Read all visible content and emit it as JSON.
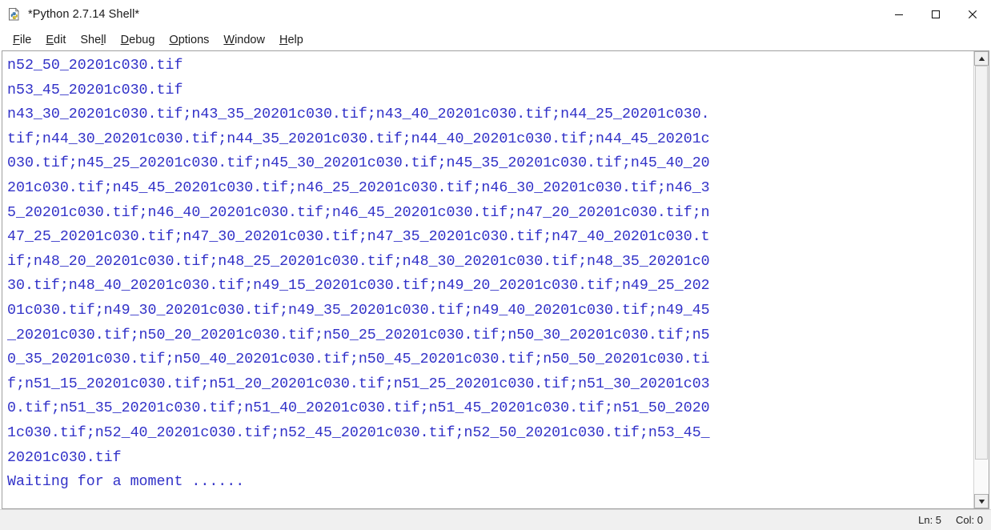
{
  "window": {
    "title": "*Python 2.7.14 Shell*",
    "icon": "python-idle-icon",
    "controls": {
      "minimize": "minimize-icon",
      "maximize": "maximize-icon",
      "close": "close-icon"
    }
  },
  "menubar": {
    "items": [
      {
        "label": "File",
        "mnemonic_index": 0
      },
      {
        "label": "Edit",
        "mnemonic_index": 0
      },
      {
        "label": "Shell",
        "mnemonic_index": 4
      },
      {
        "label": "Debug",
        "mnemonic_index": 0
      },
      {
        "label": "Options",
        "mnemonic_index": 0
      },
      {
        "label": "Window",
        "mnemonic_index": 0
      },
      {
        "label": "Help",
        "mnemonic_index": 0
      }
    ]
  },
  "shell": {
    "text_color": "#3232c8",
    "background": "#ffffff",
    "output": "n52_50_20201c030.tif\nn53_45_20201c030.tif\nn43_30_20201c030.tif;n43_35_20201c030.tif;n43_40_20201c030.tif;n44_25_20201c030.\ntif;n44_30_20201c030.tif;n44_35_20201c030.tif;n44_40_20201c030.tif;n44_45_20201c\n030.tif;n45_25_20201c030.tif;n45_30_20201c030.tif;n45_35_20201c030.tif;n45_40_20\n201c030.tif;n45_45_20201c030.tif;n46_25_20201c030.tif;n46_30_20201c030.tif;n46_3\n5_20201c030.tif;n46_40_20201c030.tif;n46_45_20201c030.tif;n47_20_20201c030.tif;n\n47_25_20201c030.tif;n47_30_20201c030.tif;n47_35_20201c030.tif;n47_40_20201c030.t\nif;n48_20_20201c030.tif;n48_25_20201c030.tif;n48_30_20201c030.tif;n48_35_20201c0\n30.tif;n48_40_20201c030.tif;n49_15_20201c030.tif;n49_20_20201c030.tif;n49_25_202\n01c030.tif;n49_30_20201c030.tif;n49_35_20201c030.tif;n49_40_20201c030.tif;n49_45\n_20201c030.tif;n50_20_20201c030.tif;n50_25_20201c030.tif;n50_30_20201c030.tif;n5\n0_35_20201c030.tif;n50_40_20201c030.tif;n50_45_20201c030.tif;n50_50_20201c030.ti\nf;n51_15_20201c030.tif;n51_20_20201c030.tif;n51_25_20201c030.tif;n51_30_20201c03\n0.tif;n51_35_20201c030.tif;n51_40_20201c030.tif;n51_45_20201c030.tif;n51_50_2020\n1c030.tif;n52_40_20201c030.tif;n52_45_20201c030.tif;n52_50_20201c030.tif;n53_45_\n20201c030.tif\nWaiting for a moment ......"
  },
  "scrollbar": {
    "up_arrow": "scroll-up-arrow-icon",
    "down_arrow": "scroll-down-arrow-icon"
  },
  "statusbar": {
    "line": "Ln: 5",
    "column": "Col: 0"
  }
}
